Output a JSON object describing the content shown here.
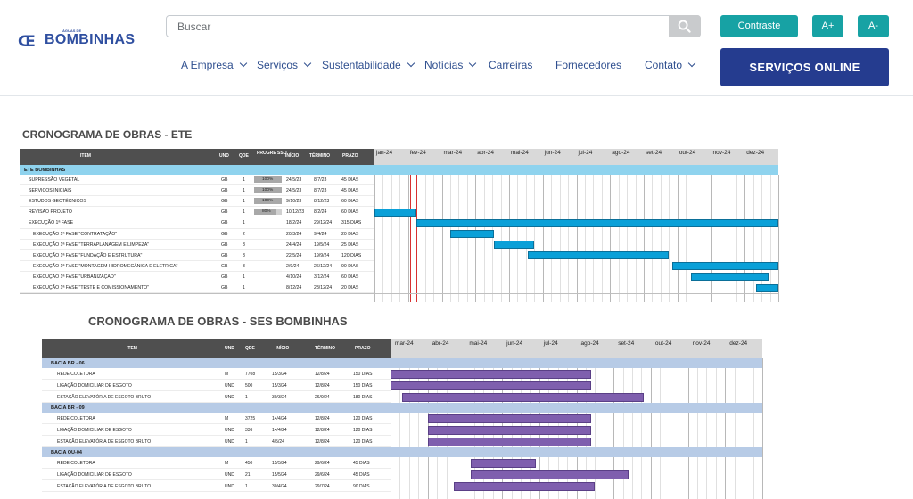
{
  "header": {
    "logo_mark": "Œ",
    "logo_small": "ÁGUAS DE",
    "logo_name": "BOMBINHAS",
    "search_placeholder": "Buscar",
    "contraste": "Contraste",
    "a_plus": "A+",
    "a_minus": "A-",
    "online": "SERVIÇOS ONLINE",
    "nav": [
      "A Empresa",
      "Serviços",
      "Sustentabilidade",
      "Notícias",
      "Carreiras",
      "Fornecedores",
      "Contato"
    ]
  },
  "ete": {
    "title": "CRONOGRAMA DE OBRAS - ETE",
    "cols": [
      "ITEM",
      "UND",
      "QDE",
      "PROGRE SSO",
      "INÍCIO",
      "TÉRMINO",
      "PRAZO"
    ],
    "months": [
      "jan-24",
      "fev-24",
      "mar-24",
      "abr-24",
      "mai-24",
      "jun-24",
      "jul-24",
      "ago-24",
      "set-24",
      "out-24",
      "nov-24",
      "dez-24"
    ],
    "section": "ETE BOMBINHAS",
    "rows": [
      {
        "item": "SUPRESSÃO VEGETAL",
        "und": "GB",
        "qde": "1",
        "prog": "100%",
        "inicio": "24/5/23",
        "termino": "8/7/23",
        "prazo": "45 DIAS",
        "progress": 1,
        "bar": null
      },
      {
        "item": "SERVIÇOS INICIAIS",
        "und": "GB",
        "qde": "1",
        "prog": "100%",
        "inicio": "24/5/23",
        "termino": "8/7/23",
        "prazo": "45 DIAS",
        "progress": 1,
        "bar": null
      },
      {
        "item": "ESTUDOS GEOTÉCNICOS",
        "und": "GB",
        "qde": "1",
        "prog": "100%",
        "inicio": "9/10/23",
        "termino": "8/12/23",
        "prazo": "60 DIAS",
        "progress": 1,
        "bar": null
      },
      {
        "item": "REVISÃO PROJETO",
        "und": "GB",
        "qde": "1",
        "prog": "80%",
        "inicio": "10/12/23",
        "termino": "8/2/24",
        "prazo": "60 DIAS",
        "progress": 0.8,
        "bar": [
          0,
          1.25
        ]
      },
      {
        "item": "EXECUÇÃO 1ª FASE",
        "und": "GB",
        "qde": "1",
        "prog": "",
        "inicio": "18/2/24",
        "termino": "29/12/24",
        "prazo": "315 DIAS",
        "progress": 0,
        "bar": [
          1.25,
          12
        ]
      },
      {
        "item": "EXECUÇÃO 1ª FASE \"CONTRATAÇÃO\"",
        "und": "GB",
        "qde": "2",
        "prog": "",
        "inicio": "20/3/24",
        "termino": "9/4/24",
        "prazo": "20 DIAS",
        "progress": 0,
        "bar": [
          2.25,
          3.55
        ]
      },
      {
        "item": "EXECUÇÃO 1ª FASE \"TERRAPLANAGEM E LIMPEZA\"",
        "und": "GB",
        "qde": "3",
        "prog": "",
        "inicio": "24/4/24",
        "termino": "19/5/24",
        "prazo": "25 DIAS",
        "progress": 0,
        "bar": [
          3.55,
          4.75
        ]
      },
      {
        "item": "EXECUÇÃO 1ª FASE \"FUNDAÇÃO E ESTRUTURA\"",
        "und": "GB",
        "qde": "3",
        "prog": "",
        "inicio": "22/5/24",
        "termino": "19/9/24",
        "prazo": "120 DIAS",
        "progress": 0,
        "bar": [
          4.55,
          8.75
        ]
      },
      {
        "item": "EXECUÇÃO 1ª FASE \"MONTAGEM HIDROMECÂNICA E ELETRICA\"",
        "und": "GB",
        "qde": "3",
        "prog": "",
        "inicio": "2/9/24",
        "termino": "26/12/24",
        "prazo": "90 DIAS",
        "progress": 0,
        "bar": [
          8.85,
          12
        ]
      },
      {
        "item": "EXECUÇÃO 1ª FASE \"URBANIZAÇÃO\"",
        "und": "GB",
        "qde": "1",
        "prog": "",
        "inicio": "4/10/24",
        "termino": "3/12/24",
        "prazo": "60 DIAS",
        "progress": 0,
        "bar": [
          9.4,
          11.7
        ]
      },
      {
        "item": "EXECUÇÃO 1ª FASE \"TESTE E COMISSIONAMENTO\"",
        "und": "GB",
        "qde": "1",
        "prog": "",
        "inicio": "8/12/24",
        "termino": "28/12/24",
        "prazo": "20 DIAS",
        "progress": 0,
        "bar": [
          11.35,
          12
        ]
      }
    ]
  },
  "ses": {
    "title": "CRONOGRAMA DE OBRAS - SES BOMBINHAS",
    "cols": [
      "ITEM",
      "UND",
      "QDE",
      "INÍCIO",
      "TÉRMINO",
      "PRAZO"
    ],
    "months": [
      "mar-24",
      "abr-24",
      "mai-24",
      "jun-24",
      "jul-24",
      "ago-24",
      "set-24",
      "out-24",
      "nov-24",
      "dez-24"
    ],
    "groups": [
      {
        "name": "BACIA BR - 06",
        "rows": [
          {
            "item": "REDE COLETORA",
            "und": "M",
            "qde": "7708",
            "inicio": "15/3/24",
            "termino": "12/8/24",
            "prazo": "150 DIAS",
            "bar": [
              0,
              5.4
            ]
          },
          {
            "item": "LIGAÇÃO DOMICILIAR DE ESGOTO",
            "und": "UND",
            "qde": "500",
            "inicio": "15/3/24",
            "termino": "12/8/24",
            "prazo": "150 DIAS",
            "bar": [
              0,
              5.4
            ]
          },
          {
            "item": "ESTAÇÃO ELEVATÓRIA DE ESGOTO BRUTO",
            "und": "UND",
            "qde": "1",
            "inicio": "30/3/24",
            "termino": "26/9/24",
            "prazo": "180 DIAS",
            "bar": [
              0.3,
              6.8
            ]
          }
        ]
      },
      {
        "name": "BACIA BR - 09",
        "rows": [
          {
            "item": "REDE COLETORA",
            "und": "M",
            "qde": "3725",
            "inicio": "14/4/24",
            "termino": "12/8/24",
            "prazo": "120 DIAS",
            "bar": [
              1.0,
              5.4
            ]
          },
          {
            "item": "LIGAÇÃO DOMICILIAR DE ESGOTO",
            "und": "UND",
            "qde": "336",
            "inicio": "14/4/24",
            "termino": "12/8/24",
            "prazo": "120 DIAS",
            "bar": [
              1.0,
              5.4
            ]
          },
          {
            "item": "ESTAÇÃO ELEVATÓRIA DE ESGOTO BRUTO",
            "und": "UND",
            "qde": "1",
            "inicio": "4/5/24",
            "termino": "12/8/24",
            "prazo": "120 DIAS",
            "bar": [
              1.0,
              5.4
            ]
          }
        ]
      },
      {
        "name": "BACIA QU-04",
        "rows": [
          {
            "item": "REDE COLETORA",
            "und": "M",
            "qde": "450",
            "inicio": "15/5/24",
            "termino": "29/6/24",
            "prazo": "45 DIAS",
            "bar": [
              2.15,
              3.9
            ]
          },
          {
            "item": "LIGAÇÃO DOMICILIAR DE ESGOTO",
            "und": "UND",
            "qde": "21",
            "inicio": "15/5/24",
            "termino": "29/6/24",
            "prazo": "45 DIAS",
            "bar": [
              2.15,
              6.4
            ]
          },
          {
            "item": "ESTAÇÃO ELEVATÓRIA DE ESGOTO BRUTO",
            "und": "UND",
            "qde": "1",
            "inicio": "30/4/24",
            "termino": "29/7/24",
            "prazo": "90 DIAS",
            "bar": [
              1.7,
              5.5
            ]
          }
        ]
      }
    ]
  },
  "colors": {
    "teal": "#17a2a4",
    "navy": "#253c8f",
    "ete_bar": "#0aa0d8",
    "ses_bar": "#7f5fae",
    "section_bg": "#8fd3ee",
    "group_bg": "#b7cbe6"
  }
}
